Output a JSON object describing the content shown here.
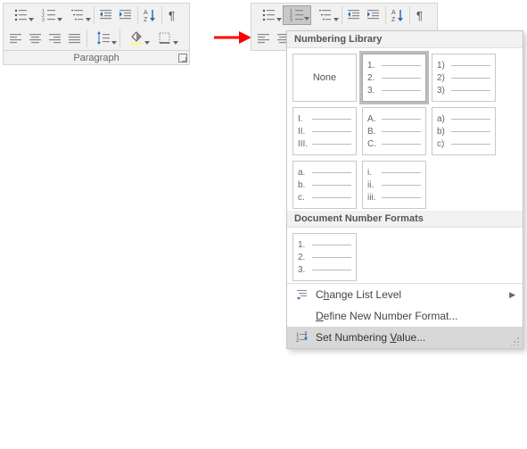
{
  "group_label": "Paragraph",
  "arrow_color": "#ff0000",
  "dropdown": {
    "section_library": "Numbering Library",
    "section_docfmt": "Document Number Formats",
    "none_label": "None",
    "formats": [
      [
        "1.",
        "2.",
        "3."
      ],
      [
        "1)",
        "2)",
        "3)"
      ],
      [
        "I.",
        "II.",
        "III."
      ],
      [
        "A.",
        "B.",
        "C."
      ],
      [
        "a)",
        "b)",
        "c)"
      ],
      [
        "a.",
        "b.",
        "c."
      ],
      [
        "i.",
        "ii.",
        "iii."
      ]
    ],
    "doc_formats": [
      [
        "1.",
        "2.",
        "3."
      ]
    ],
    "menu": {
      "change_level_pre": "C",
      "change_level_u": "h",
      "change_level_post": "ange List Level",
      "define_pre": "",
      "define_u": "D",
      "define_post": "efine New Number Format...",
      "setval_pre": "Set Numbering ",
      "setval_u": "V",
      "setval_post": "alue..."
    }
  }
}
